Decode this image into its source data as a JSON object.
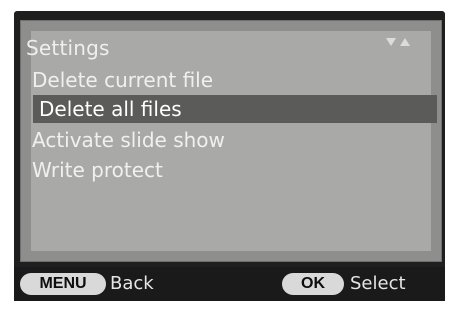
{
  "menu": {
    "title": "Settings",
    "items": [
      {
        "label": "Delete current file",
        "selected": false
      },
      {
        "label": "Delete all files",
        "selected": true
      },
      {
        "label": "Activate slide show",
        "selected": false
      },
      {
        "label": "Write protect",
        "selected": false
      }
    ],
    "scroll_icons": [
      "triangle-down-icon",
      "triangle-up-icon"
    ]
  },
  "footer": {
    "menu_key": "MENU",
    "menu_action": "Back",
    "ok_key": "OK",
    "ok_action": "Select"
  },
  "colors": {
    "lcd_bg": "#a9a9a7",
    "selected_row": "#5b5b5a",
    "text": "#f0f0f0",
    "frame": "#1f1f1f"
  }
}
